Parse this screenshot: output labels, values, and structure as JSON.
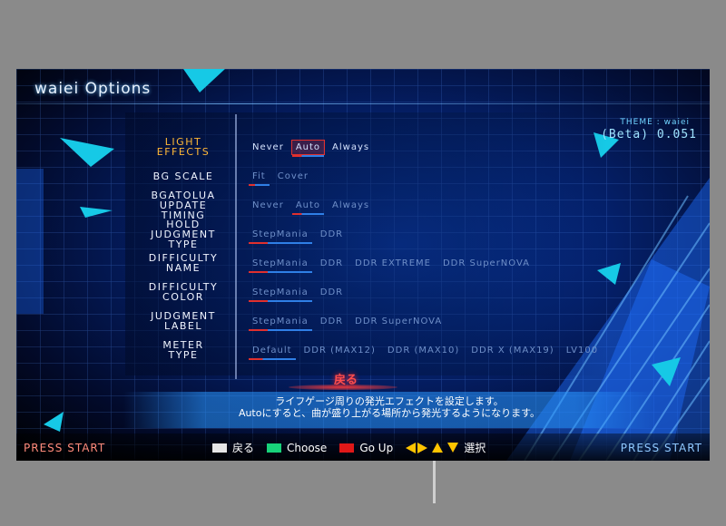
{
  "window": {
    "title": "waiei Options"
  },
  "theme": {
    "label": "THEME : waiei",
    "version": "(Beta) 0.051"
  },
  "options": [
    {
      "name": "LIGHT\nEFFECTS",
      "choices": [
        "Never",
        "Auto",
        "Always"
      ],
      "selected": 1,
      "active": true
    },
    {
      "name": "BG SCALE",
      "choices": [
        "Fit",
        "Cover"
      ],
      "selected": 0,
      "active": false
    },
    {
      "name": "BGATOLUA\nUPDATE\nTIMING",
      "choices": [
        "Never",
        "Auto",
        "Always"
      ],
      "selected": 1,
      "active": false
    },
    {
      "name": "HOLD\nJUDGMENT\nTYPE",
      "choices": [
        "StepMania",
        "DDR"
      ],
      "selected": 0,
      "active": false
    },
    {
      "name": "DIFFICULTY\nNAME",
      "choices": [
        "StepMania",
        "DDR",
        "DDR EXTREME",
        "DDR SuperNOVA"
      ],
      "selected": 0,
      "active": false
    },
    {
      "name": "DIFFICULTY\nCOLOR",
      "choices": [
        "StepMania",
        "DDR"
      ],
      "selected": 0,
      "active": false
    },
    {
      "name": "JUDGMENT\nLABEL",
      "choices": [
        "StepMania",
        "DDR",
        "DDR SuperNOVA"
      ],
      "selected": 0,
      "active": false
    },
    {
      "name": "METER\nTYPE",
      "choices": [
        "Default",
        "DDR (MAX12)",
        "DDR (MAX10)",
        "DDR X (MAX19)",
        "LV100"
      ],
      "selected": 0,
      "active": false
    }
  ],
  "back_label": "戻る",
  "explanation": {
    "line1": "ライフゲージ周りの発光エフェクトを設定します。",
    "line2": "Autoにすると、曲が盛り上がる場所から発光するようになります。"
  },
  "footer": {
    "press_start_left": "PRESS START",
    "press_start_right": "PRESS START",
    "legend": [
      {
        "color": "#e6e6e6",
        "label": "戻る"
      },
      {
        "color": "#18d27a",
        "label": "Choose"
      },
      {
        "color": "#e01818",
        "label": "Go Up"
      }
    ],
    "arrows_label": "選択"
  },
  "colors": {
    "active_option": "#ffb836",
    "accent_red": "#e0302e",
    "accent_blue": "#2f7fe6"
  }
}
